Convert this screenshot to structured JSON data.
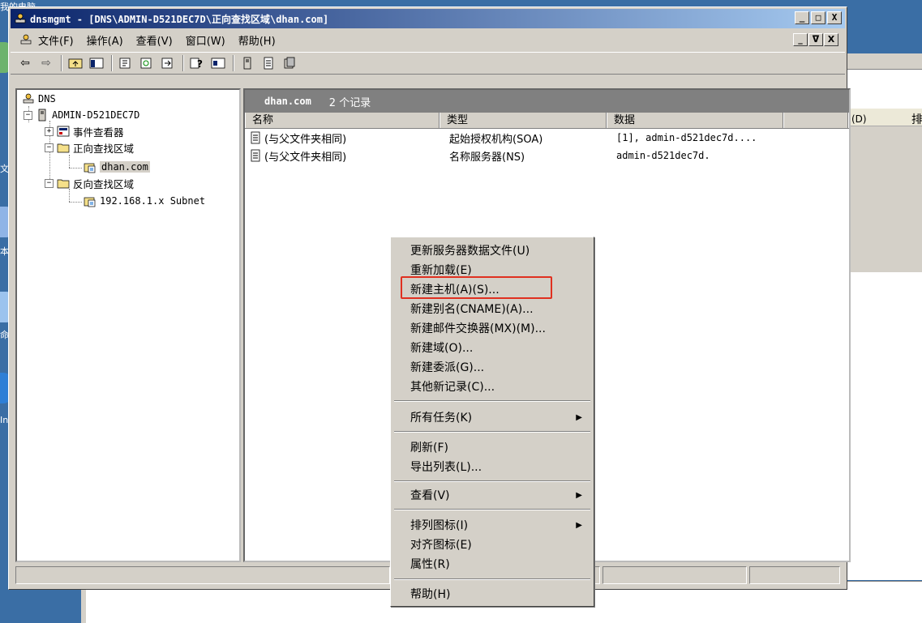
{
  "desktop": {
    "labels": [
      "我的电脑",
      "文",
      "本地",
      "命令",
      "Internet"
    ]
  },
  "window": {
    "title": "dnsmgmt - [DNS\\ADMIN-D521DEC7D\\正向查找区域\\dhan.com]",
    "min": "_",
    "max": "□",
    "close": "X"
  },
  "menubar": {
    "items": [
      "文件(F)",
      "操作(A)",
      "查看(V)",
      "窗口(W)",
      "帮助(H)"
    ],
    "mdi_min": "_",
    "mdi_restore": "ᐁ",
    "mdi_close": "X"
  },
  "tree": {
    "root": "DNS",
    "server": "ADMIN-D521DEC7D",
    "event_viewer": "事件查看器",
    "forward_zones": "正向查找区域",
    "forward_zone_item": "dhan.com",
    "reverse_zones": "反向查找区域",
    "reverse_zone_item": "192.168.1.x Subnet"
  },
  "list": {
    "zone_name": "dhan.com",
    "record_count": "2 个记录",
    "columns": [
      "名称",
      "类型",
      "数据"
    ],
    "rows": [
      {
        "name": "(与父文件夹相同)",
        "type": "起始授权机构(SOA)",
        "data": "[1], admin-d521dec7d...."
      },
      {
        "name": "(与父文件夹相同)",
        "type": "名称服务器(NS)",
        "data": "admin-d521dec7d."
      }
    ]
  },
  "background_window": {
    "col1": "(D)",
    "col2": "排"
  },
  "context_menu": {
    "items": [
      "更新服务器数据文件(U)",
      "重新加载(E)",
      "新建主机(A)(S)...",
      "新建别名(CNAME)(A)...",
      "新建邮件交换器(MX)(M)...",
      "新建域(O)...",
      "新建委派(G)...",
      "其他新记录(C)...",
      "所有任务(K)",
      "刷新(F)",
      "导出列表(L)...",
      "查看(V)",
      "排列图标(I)",
      "对齐图标(E)",
      "属性(R)",
      "帮助(H)"
    ],
    "highlighted": "新建主机(A)(S)..."
  },
  "colors": {
    "title_start": "#0a246a",
    "title_end": "#a6caf0",
    "desktop": "#3a6ea5",
    "highlight_box": "#e03020",
    "banner": "#808080"
  }
}
